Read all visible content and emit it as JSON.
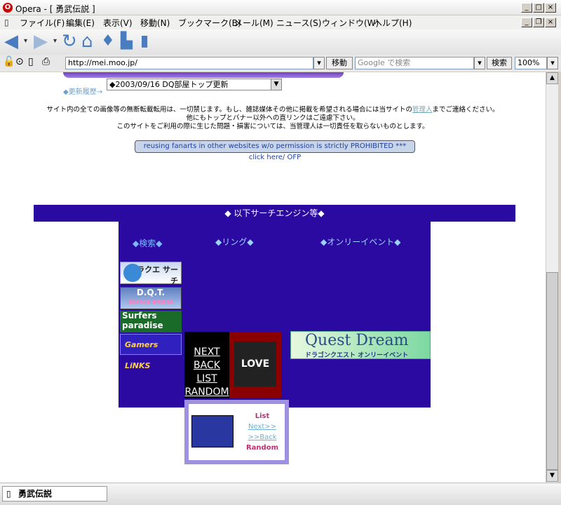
{
  "window": {
    "title": "Opera - [ 勇武伝説 ]"
  },
  "menu": [
    "ファイル(F)",
    "編集(E)",
    "表示(V)",
    "移動(N)",
    "ブックマーク(B)",
    "メール(M)",
    "ニュース(S)",
    "ウィンドウ(W)",
    "ヘルプ(H)"
  ],
  "address": {
    "url": "http://mei.moo.jp/",
    "go_label": "移動",
    "search_placeholder": "Google で検索",
    "search_label": "検索",
    "zoom": "100%"
  },
  "page": {
    "update_history_label": "◆更新履歴→",
    "update_select_value": "◆2003/09/16 DQ部屋トップ更新",
    "notice_line1_pre": "サイト内の全ての画像等の無断転載転用は、一切禁じます。もし、雑誌媒体その他に掲載を希望される場合には当サイトの",
    "notice_line1_link": "管理人",
    "notice_line1_post": "までご連絡ください。",
    "notice_line2": "他にもトップとバナー以外への直リンクはご遠慮下さい。",
    "notice_line3": "このサイトをご利用の際に生じた問題・損害については、当管理人は一切責任を取らないものとします。",
    "english_notice": "reusing fanarts in other websites w/o permission is strictly PROHIBITED *** click here/ OFP",
    "search_engines_header": "◆ 以下サーチエンジン等◆",
    "col_search": "◆検索◆",
    "col_ring": "◆リング◆",
    "col_event": "◆オンリーイベント◆",
    "ring_links": [
      "NEXT",
      "BACK",
      "LIST",
      "RANDOM"
    ],
    "ring2_links": {
      "list": "List",
      "next": "Next>>",
      "back": ">>Back",
      "random": "Random"
    },
    "banners": {
      "draque": "ドラクエ サーチ",
      "dqt": "D.Q.T.",
      "dqt_sub": "SEARCH ENGINE",
      "surfers": "Surfers paradise",
      "gamers": "Gamers LiNKS",
      "love": "LOVE",
      "quest_dream": "Quest Dream",
      "quest_dream_sub": "ドラゴンクエスト オンリーイベント"
    }
  },
  "status": {
    "tab_title": "勇武伝説"
  }
}
